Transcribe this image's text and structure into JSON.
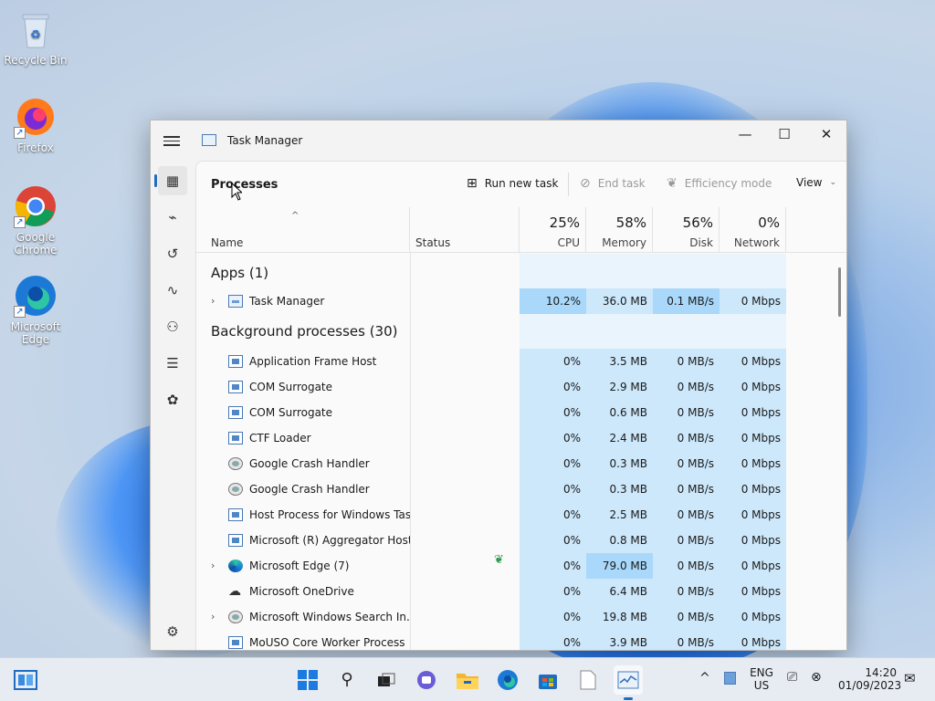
{
  "desktop": {
    "icons": [
      {
        "label": "Recycle Bin",
        "icon": "recycle-bin-icon"
      },
      {
        "label": "Firefox",
        "icon": "firefox-icon"
      },
      {
        "label": "Google Chrome",
        "icon": "chrome-icon"
      },
      {
        "label": "Microsoft Edge",
        "icon": "edge-icon"
      }
    ]
  },
  "window": {
    "title": "Task Manager",
    "controls": {
      "minimize": "—",
      "maximize": "☐",
      "close": "✕"
    }
  },
  "sidebar": {
    "items": [
      {
        "name": "processes",
        "icon": "processes-icon",
        "active": true
      },
      {
        "name": "performance",
        "icon": "performance-icon"
      },
      {
        "name": "app-history",
        "icon": "history-icon"
      },
      {
        "name": "startup-apps",
        "icon": "startup-icon"
      },
      {
        "name": "users",
        "icon": "users-icon"
      },
      {
        "name": "details",
        "icon": "details-icon"
      },
      {
        "name": "services",
        "icon": "services-icon"
      },
      {
        "name": "settings",
        "icon": "settings-icon"
      }
    ]
  },
  "toolbar": {
    "page_title": "Processes",
    "run_new_task": "Run new task",
    "end_task": "End task",
    "efficiency_mode": "Efficiency mode",
    "view": "View"
  },
  "columns": {
    "name": "Name",
    "status": "Status",
    "cpu": {
      "pct": "25%",
      "label": "CPU"
    },
    "memory": {
      "pct": "58%",
      "label": "Memory"
    },
    "disk": {
      "pct": "56%",
      "label": "Disk"
    },
    "network": {
      "pct": "0%",
      "label": "Network"
    }
  },
  "groups": {
    "apps": "Apps (1)",
    "background": "Background processes (30)"
  },
  "apps": [
    {
      "name": "Task Manager",
      "cpu": "10.2%",
      "memory": "36.0 MB",
      "disk": "0.1 MB/s",
      "network": "0 Mbps"
    }
  ],
  "background": [
    {
      "name": "Application Frame Host",
      "cpu": "0%",
      "memory": "3.5 MB",
      "disk": "0 MB/s",
      "network": "0 Mbps"
    },
    {
      "name": "COM Surrogate",
      "cpu": "0%",
      "memory": "2.9 MB",
      "disk": "0 MB/s",
      "network": "0 Mbps"
    },
    {
      "name": "COM Surrogate",
      "cpu": "0%",
      "memory": "0.6 MB",
      "disk": "0 MB/s",
      "network": "0 Mbps"
    },
    {
      "name": "CTF Loader",
      "cpu": "0%",
      "memory": "2.4 MB",
      "disk": "0 MB/s",
      "network": "0 Mbps"
    },
    {
      "name": "Google Crash Handler",
      "cpu": "0%",
      "memory": "0.3 MB",
      "disk": "0 MB/s",
      "network": "0 Mbps"
    },
    {
      "name": "Google Crash Handler",
      "cpu": "0%",
      "memory": "0.3 MB",
      "disk": "0 MB/s",
      "network": "0 Mbps"
    },
    {
      "name": "Host Process for Windows Tasks",
      "cpu": "0%",
      "memory": "2.5 MB",
      "disk": "0 MB/s",
      "network": "0 Mbps"
    },
    {
      "name": "Microsoft (R) Aggregator Host",
      "cpu": "0%",
      "memory": "0.8 MB",
      "disk": "0 MB/s",
      "network": "0 Mbps"
    },
    {
      "name": "Microsoft Edge (7)",
      "cpu": "0%",
      "memory": "79.0 MB",
      "disk": "0 MB/s",
      "network": "0 Mbps"
    },
    {
      "name": "Microsoft OneDrive",
      "cpu": "0%",
      "memory": "6.4 MB",
      "disk": "0 MB/s",
      "network": "0 Mbps"
    },
    {
      "name": "Microsoft Windows Search In...",
      "cpu": "0%",
      "memory": "19.8 MB",
      "disk": "0 MB/s",
      "network": "0 Mbps"
    },
    {
      "name": "MoUSO Core Worker Process",
      "cpu": "0%",
      "memory": "3.9 MB",
      "disk": "0 MB/s",
      "network": "0 Mbps"
    }
  ],
  "taskbar": {
    "apps": [
      "start-icon",
      "search-icon",
      "task-view-icon",
      "chat-icon",
      "file-explorer-icon",
      "edge-icon",
      "store-icon",
      "notepad-icon",
      "task-manager-icon"
    ],
    "language": "ENG",
    "region": "US",
    "time": "14:20",
    "date": "01/09/2023"
  }
}
